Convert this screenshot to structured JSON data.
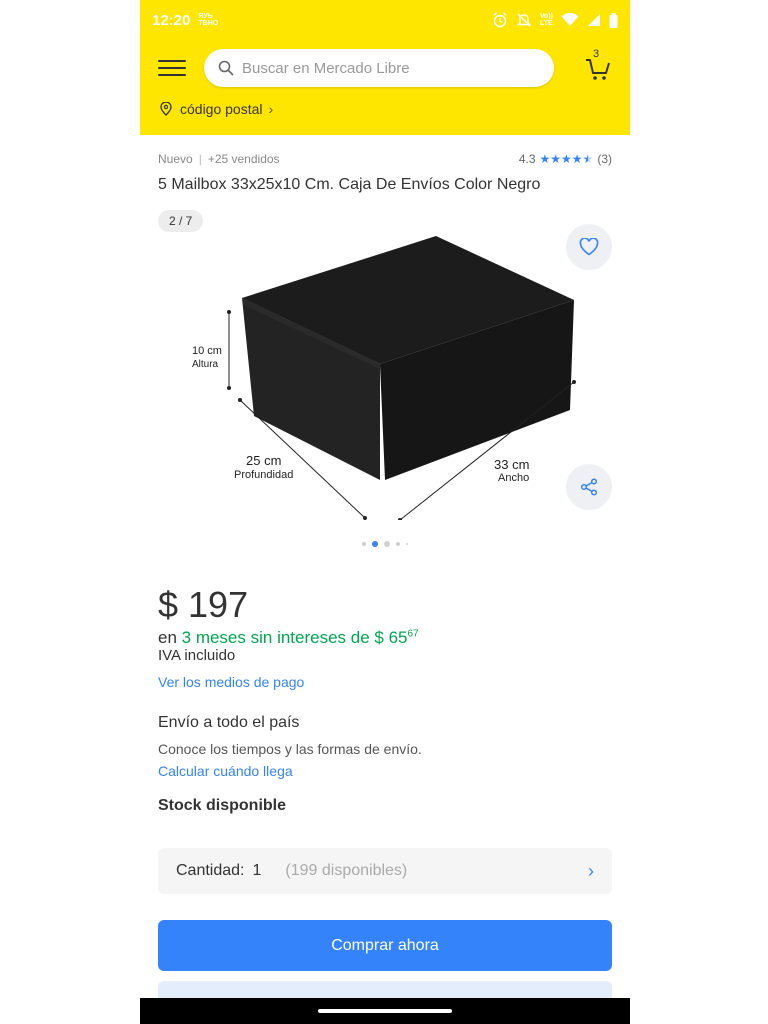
{
  "status_bar": {
    "time": "12:20",
    "small_text_top": "ЯУЬ",
    "small_text_bottom": "ТВНО",
    "network": "LTE"
  },
  "header": {
    "search_placeholder": "Buscar en Mercado Libre",
    "cart_count": "3",
    "postal_label": "código postal",
    "brand_color": "#ffe600"
  },
  "product": {
    "condition": "Nuevo",
    "sold": "+25 vendidos",
    "rating": "4.3",
    "stars": 4.3,
    "reviews": "(3)",
    "title": "5 Mailbox 33x25x10 Cm. Caja De Envíos Color Negro",
    "image_counter": "2 / 7",
    "image_labels": {
      "height_value": "10 cm",
      "height_label": "Altura",
      "depth_value": "25 cm",
      "depth_label": "Profundidad",
      "width_value": "33 cm",
      "width_label": "Ancho"
    }
  },
  "price": {
    "amount": "$ 197",
    "installments_prefix": "en ",
    "installments_green": "3 meses sin intereses de $ 65",
    "installments_cents": "67",
    "iva": "IVA incluido",
    "payment_link": "Ver los medios de pago"
  },
  "shipping": {
    "title": "Envío a todo el país",
    "description": "Conoce los tiempos y las formas de envío.",
    "link": "Calcular cuándo llega"
  },
  "stock": {
    "title": "Stock disponible",
    "quantity_label": "Cantidad:",
    "quantity_value": "1",
    "available": "(199 disponibles)"
  },
  "actions": {
    "buy_now": "Comprar ahora",
    "accent_color": "#3483fa"
  }
}
